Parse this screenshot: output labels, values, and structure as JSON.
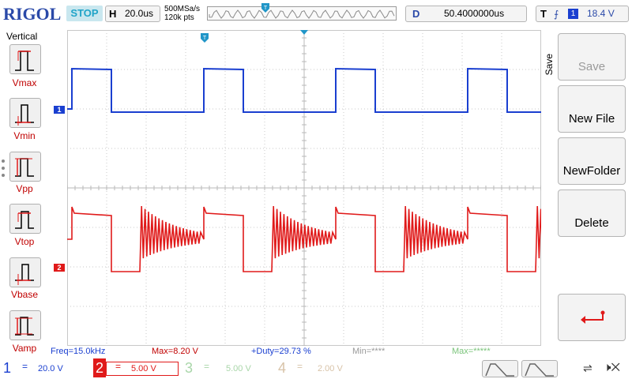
{
  "brand": "RIGOL",
  "run_status": "STOP",
  "horizontal": {
    "label": "H",
    "timebase": "20.0us"
  },
  "acquisition": {
    "sample_rate": "500MSa/s",
    "memory_depth": "120k pts"
  },
  "delay": {
    "label": "D",
    "value": "50.4000000us"
  },
  "trigger": {
    "label": "T",
    "edge_icon": "rising-edge-icon",
    "source": "1",
    "level": "18.4 V"
  },
  "left_menu": {
    "title": "Vertical",
    "items": [
      {
        "label": "Vmax",
        "icon": "vmax-icon"
      },
      {
        "label": "Vmin",
        "icon": "vmin-icon"
      },
      {
        "label": "Vpp",
        "icon": "vpp-icon"
      },
      {
        "label": "Vtop",
        "icon": "vtop-icon"
      },
      {
        "label": "Vbase",
        "icon": "vbase-icon"
      },
      {
        "label": "Vamp",
        "icon": "vamp-icon"
      }
    ]
  },
  "right_menu": {
    "title": "Save",
    "keys": [
      {
        "label": "Save",
        "enabled": false
      },
      {
        "label": "New File",
        "enabled": true
      },
      {
        "label": "NewFolder",
        "enabled": true
      },
      {
        "label": "Delete",
        "enabled": true
      },
      {
        "label": "",
        "icon": "return-arrow-icon"
      }
    ]
  },
  "channel_markers": {
    "ch1": "1",
    "ch2": "2"
  },
  "measurements": {
    "freq": "Freq=15.0kHz",
    "max": "Max=8.20 V",
    "duty": "+Duty=29.73 %",
    "min": "Min=****",
    "max2": "Max=*****"
  },
  "channels": [
    {
      "num": "1",
      "coupling": "=",
      "scale": "20.0 V",
      "color": "#1a3fd0"
    },
    {
      "num": "2",
      "coupling": "=",
      "scale": "5.00 V",
      "color": "#e01a1a"
    },
    {
      "num": "3",
      "coupling": "=",
      "scale": "5.00 V",
      "color": "#a9d6a9"
    },
    {
      "num": "4",
      "coupling": "=",
      "scale": "2.00 V",
      "color": "#d8c3a8"
    }
  ],
  "waveform_buttons": [
    "math-wave-icon",
    "ref-wave-icon"
  ],
  "status_icons": [
    "usb-icon",
    "speaker-mute-icon"
  ],
  "colors": {
    "ch1": "#1a3fd0",
    "ch2": "#e01a1a",
    "brand": "#2a49a8",
    "stop": "#20a4c8"
  }
}
